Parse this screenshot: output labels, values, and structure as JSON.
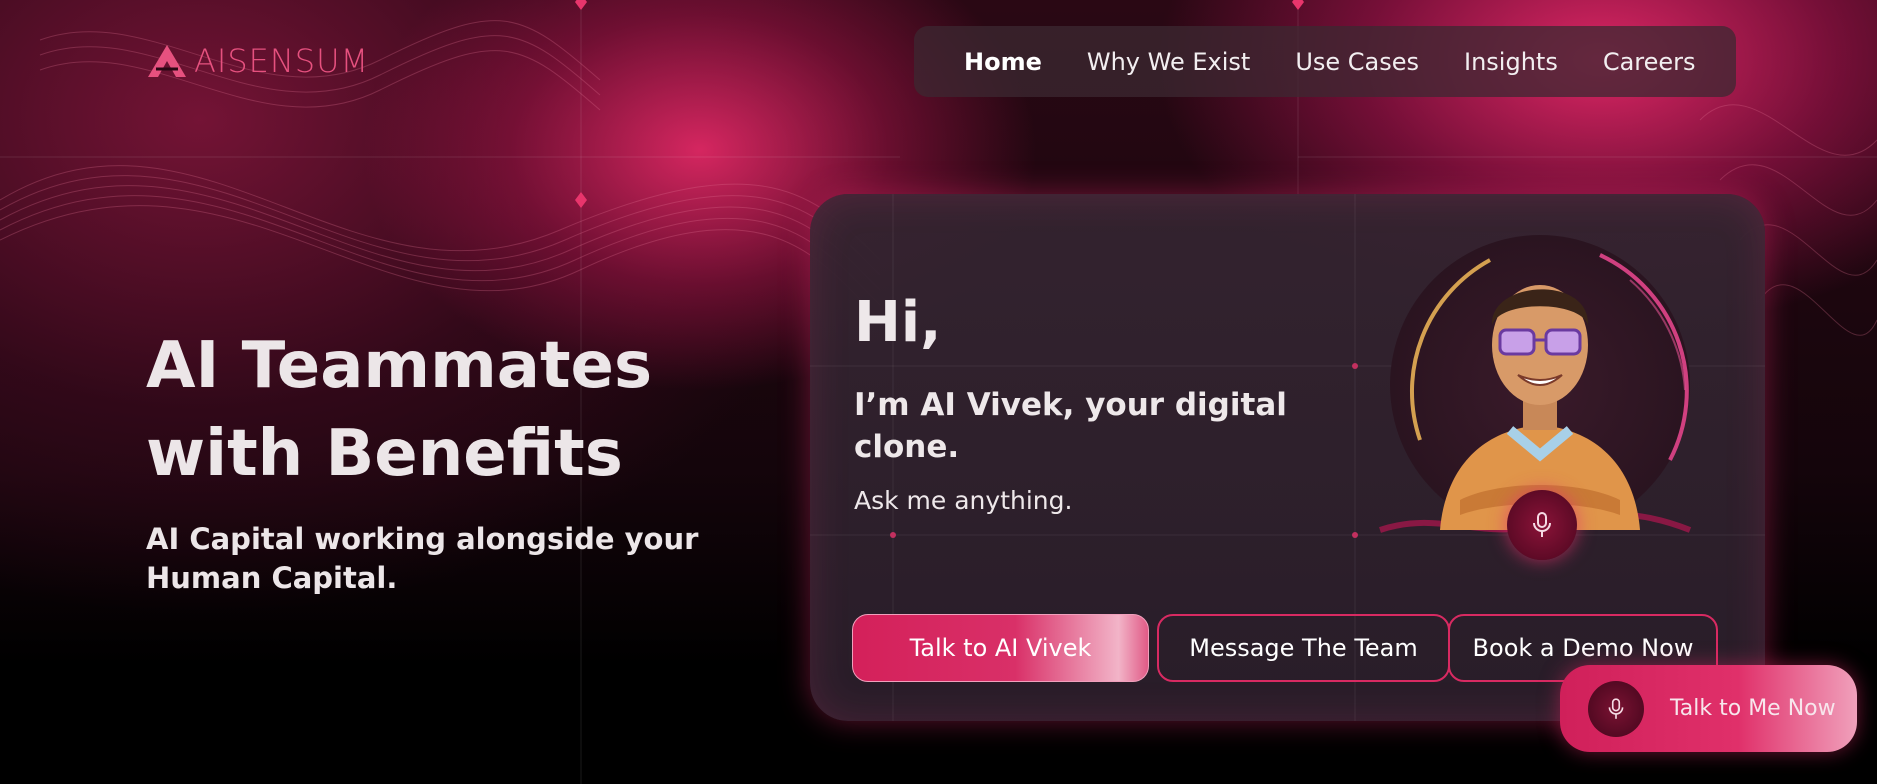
{
  "brand": {
    "name": "AISENSUM",
    "color": "#e6517f",
    "icon": "triangle-logo-icon"
  },
  "nav": {
    "items": [
      {
        "label": "Home",
        "active": true
      },
      {
        "label": "Why We Exist",
        "active": false
      },
      {
        "label": "Use Cases",
        "active": false
      },
      {
        "label": "Insights",
        "active": false
      },
      {
        "label": "Careers",
        "active": false
      }
    ]
  },
  "hero": {
    "title_line1": "AI Teammates",
    "title_line2": "with Benefits",
    "subtitle": "AI Capital working alongside your Human Capital."
  },
  "card": {
    "greeting": "Hi,",
    "intro": "I’m AI Vivek, your digital clone.",
    "prompt": "Ask me anything.",
    "avatar_icon": "ai-vivek-avatar-icon",
    "mic_icon": "microphone-icon",
    "buttons": {
      "talk": "Talk to AI Vivek",
      "message": "Message The Team",
      "demo": "Book a Demo Now"
    }
  },
  "floating": {
    "label": "Talk to Me Now",
    "icon": "microphone-icon"
  },
  "colors": {
    "accent": "#d8205c",
    "background": "#000000",
    "card": "#302230"
  }
}
